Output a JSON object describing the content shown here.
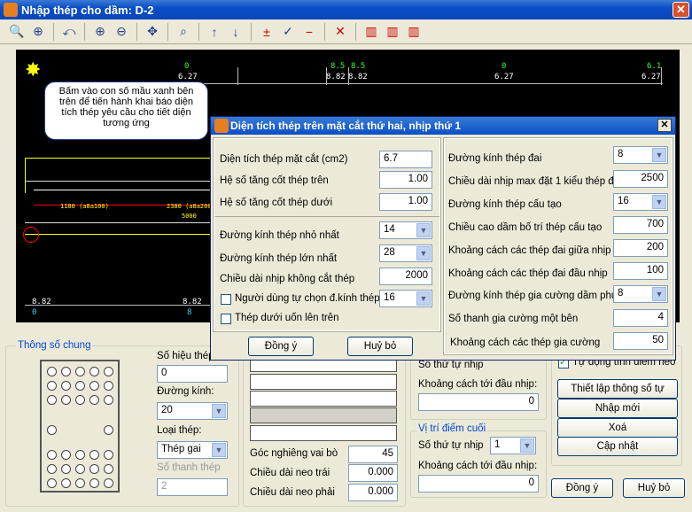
{
  "window": {
    "title": "Nhập thép cho dầm: D-2"
  },
  "canvas": {
    "top_labels": [
      "0",
      "8.5",
      "8.5",
      "0",
      "6.1"
    ],
    "mid_labels": [
      "6.27",
      "8.82",
      "8.82",
      "6.27",
      "6.27"
    ],
    "bottom_labels": [
      "8.82",
      "8.82"
    ],
    "bottom_cyan": [
      "0",
      "8"
    ],
    "dim1": "1180 (a8a100)",
    "dim2": "2380 (a8a200)",
    "dim3": "5000"
  },
  "tooltip": {
    "text": "Bấm vào con số mầu xanh bên trên để tiến hành khai báo diện tích thép yêu cầu cho tiết diện tương ứng"
  },
  "dialog": {
    "title": "Diện tích thép trên mặt cắt thứ hai, nhịp thứ 1",
    "area_label": "Diện tích thép mặt cắt (cm2)",
    "area_value": "6.7",
    "top_factor_label": "Hệ số tăng cốt thép trên",
    "top_factor_value": "1.00",
    "bottom_factor_label": "Hệ số tăng cốt thép dưới",
    "bottom_factor_value": "1.00",
    "min_dia_label": "Đường kính thép nhỏ nhất",
    "min_dia_value": "14",
    "max_dia_label": "Đường kính thép lớn nhất",
    "max_dia_value": "28",
    "nocut_label": "Chiều dài nhịp không cắt thép",
    "nocut_value": "2000",
    "user_choose_label": "Người dùng tự chọn đ.kính thép",
    "user_choose_value": "16",
    "bend_label": "Thép dưới uốn lên trên",
    "stirrup_dia_label": "Đường kính thép đai",
    "stirrup_dia_value": "8",
    "max_span_label": "Chiều dài nhịp max đặt 1 kiểu thép đai",
    "max_span_value": "2500",
    "struct_dia_label": "Đường kính thép cấu tạo",
    "struct_dia_value": "16",
    "beam_height_label": "Chiều cao dầm bố trí thép cấu tạo",
    "beam_height_value": "700",
    "mid_spacing_label": "Khoảng cách các thép đai giữa nhịp",
    "mid_spacing_value": "200",
    "end_spacing_label": "Khoảng cách các thép đai đầu nhịp",
    "end_spacing_value": "100",
    "sub_dia_label": "Đường kính thép gia cường dầm phụ",
    "sub_dia_value": "8",
    "count_label": "Số thanh gia cường một bên",
    "count_value": "4",
    "sub_spacing_label": "Khoảng cách các thép gia cường",
    "sub_spacing_value": "50",
    "ok": "Đồng ý",
    "cancel": "Huỷ bỏ"
  },
  "bottom": {
    "general_legend": "Thông số chung",
    "bar_no_label": "Số hiệu thép",
    "bar_no_value": "0",
    "dia_label": "Đường kính:",
    "dia_value": "20",
    "type_label": "Loại thép:",
    "type_value": "Thép gai",
    "count_label": "Số thanh thép",
    "count_value": "2",
    "hook_angle_label": "Góc nghiêng vai bò",
    "hook_angle_value": "45",
    "anchor_left_label": "Chiều dài neo trái",
    "anchor_left_value": "0.000",
    "anchor_right_label": "Chiều dài neo phải",
    "anchor_right_value": "0.000",
    "span_order_label": "Số thứ tự nhịp",
    "span_order_value": "1",
    "dist_start_label": "Khoảng cách tới đầu nhịp:",
    "dist_start_value": "0",
    "end_point_legend": "Vị trí điểm cuối",
    "span_order2_label": "Số thứ tự nhịp",
    "span_order2_value": "1",
    "dist_start2_label": "Khoảng cách tới đầu nhịp:",
    "dist_start2_value": "0",
    "auto_label": "Tự động tính điểm neo",
    "btn_auto": "Thiết lập thông số tự động",
    "btn_new": "Nhập mới",
    "btn_delete": "Xoá",
    "btn_update": "Cập nhật",
    "ok": "Đồng ý",
    "cancel": "Huỷ bỏ"
  }
}
